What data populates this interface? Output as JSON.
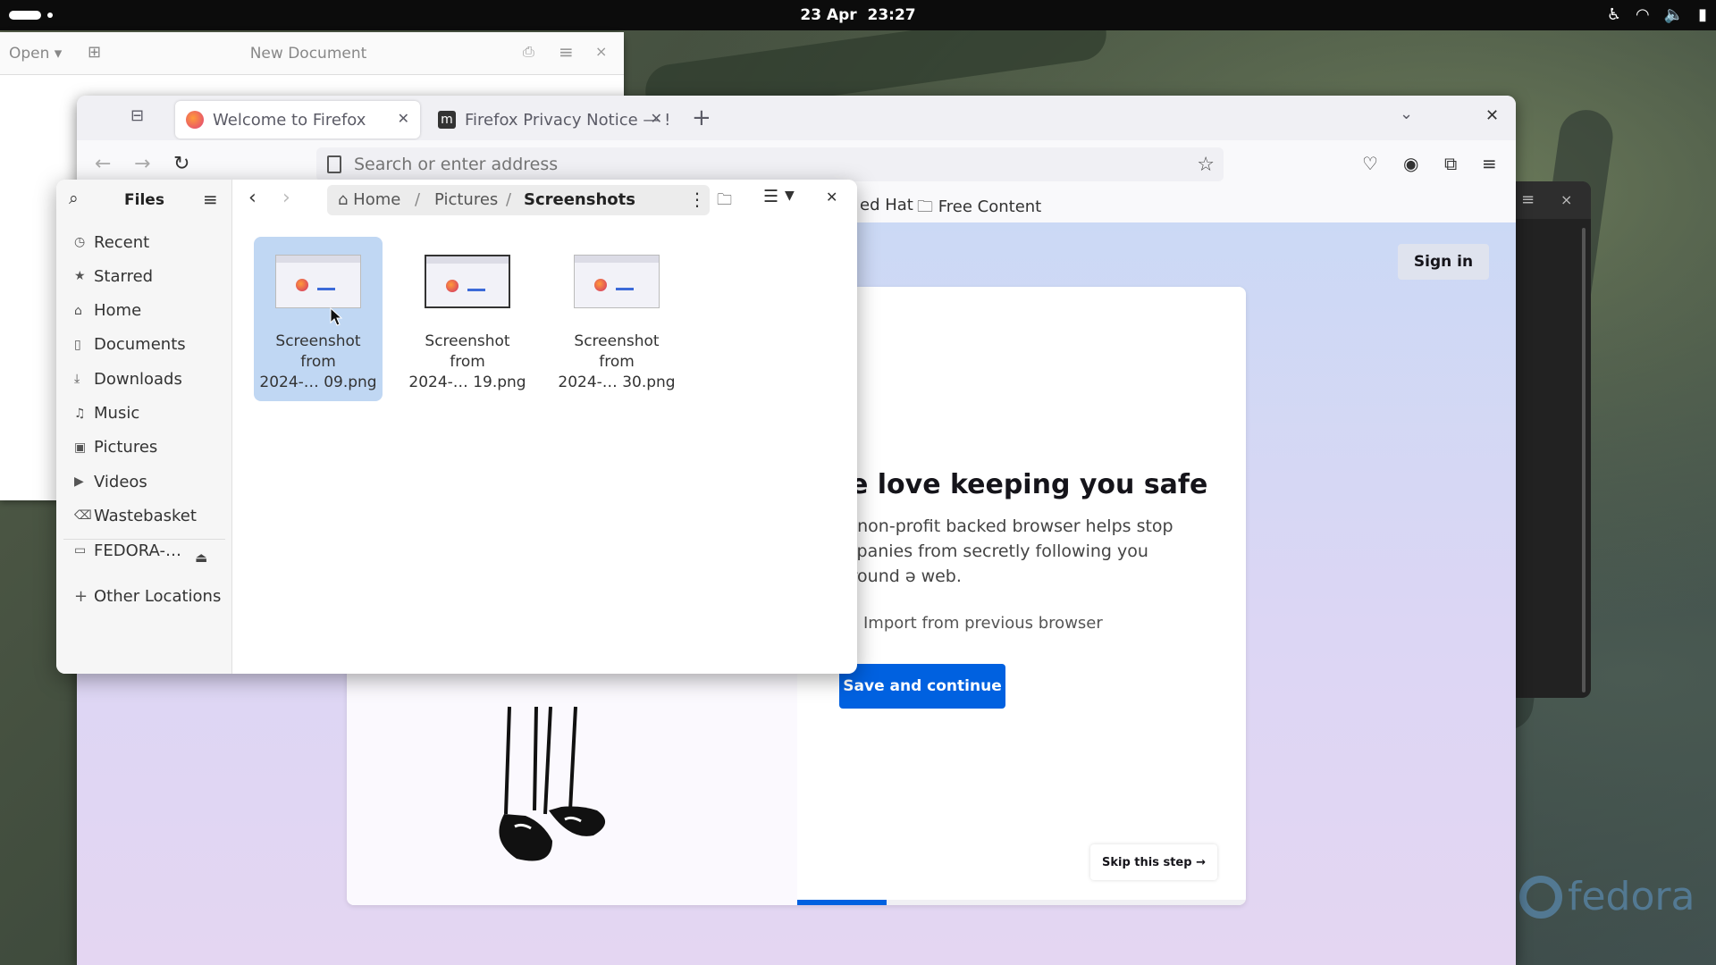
{
  "topbar": {
    "date": "23 Apr",
    "time": "23:27",
    "tray_icons": [
      "accessibility-icon",
      "wifi-icon",
      "volume-icon",
      "battery-icon"
    ]
  },
  "editor": {
    "open_label": "Open ▾",
    "title": "New Document",
    "new_tab": "⊞",
    "save": "⎙",
    "menu": "≡",
    "close": "×"
  },
  "firefox": {
    "tabs": [
      {
        "label": "Welcome to Firefox",
        "active": true
      },
      {
        "label": "Firefox Privacy Notice — !",
        "active": false
      }
    ],
    "new_tab": "+",
    "url_placeholder": "Search or enter address",
    "bookmarks": [
      "ed Hat",
      "Free Content"
    ],
    "content": {
      "sign_in": "Sign in",
      "heading": "/e love keeping you safe",
      "subtext": "ır non-profit backed browser helps stop mpanies from secretly following you around ə web.",
      "import_label": "Import from previous browser",
      "save_continue": "Save and continue",
      "skip": "Skip this step →",
      "progress": 0.2
    }
  },
  "files": {
    "title": "Files",
    "sidebar": [
      {
        "icon": "clock-icon",
        "glyph": "◷",
        "label": "Recent"
      },
      {
        "icon": "star-icon",
        "glyph": "★",
        "label": "Starred"
      },
      {
        "icon": "home-icon",
        "glyph": "⌂",
        "label": "Home"
      },
      {
        "icon": "document-icon",
        "glyph": "▯",
        "label": "Documents"
      },
      {
        "icon": "download-icon",
        "glyph": "⤓",
        "label": "Downloads"
      },
      {
        "icon": "music-icon",
        "glyph": "♫",
        "label": "Music"
      },
      {
        "icon": "picture-icon",
        "glyph": "▣",
        "label": "Pictures"
      },
      {
        "icon": "video-icon",
        "glyph": "▶",
        "label": "Videos"
      },
      {
        "icon": "trash-icon",
        "glyph": "⌫",
        "label": "Wastebasket"
      }
    ],
    "drive": {
      "label": "FEDORA-…",
      "glyph": "▭"
    },
    "other_locations": "Other Locations",
    "path": {
      "home": "Home",
      "pictures": "Pictures",
      "current": "Screenshots",
      "sep": "/"
    },
    "items": [
      {
        "line1": "Screenshot",
        "line2": "from",
        "line3": "2024-… 09.png",
        "selected": true
      },
      {
        "line1": "Screenshot",
        "line2": "from",
        "line3": "2024-… 19.png",
        "selected": false
      },
      {
        "line1": "Screenshot",
        "line2": "from",
        "line3": "2024-… 30.png",
        "selected": false
      }
    ]
  },
  "desktop": {
    "brand": "fedora"
  }
}
